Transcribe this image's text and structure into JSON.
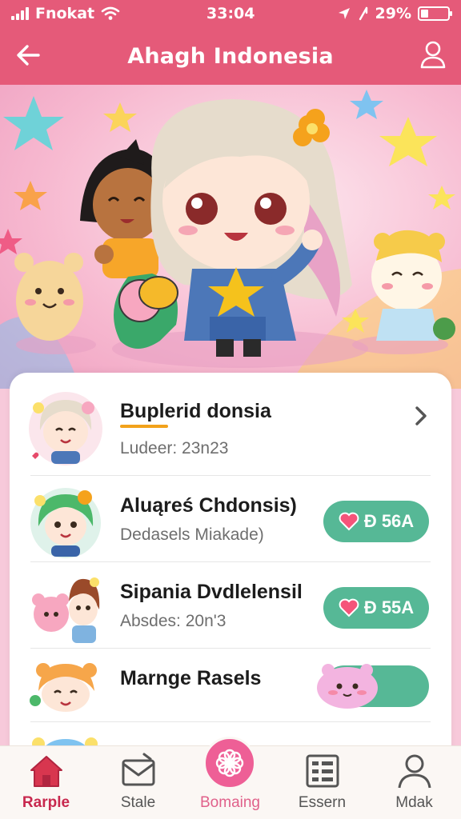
{
  "status_bar": {
    "carrier": "Fnokat",
    "time": "33:04",
    "battery": "29%",
    "battery_level": 0.29
  },
  "header": {
    "title": "Ahagh Indonesia"
  },
  "list": [
    {
      "title": "Buplerid donsia",
      "subtitle": "Ludeer: 23n23",
      "action": "chevron"
    },
    {
      "title": "Aluąreś Chdonsis)",
      "subtitle": "Dedasels Miakade)",
      "action": "pill",
      "pill_text": "Ð 56A"
    },
    {
      "title": "Sipania Dvdlelensil",
      "subtitle": "Absdes: 20n'3",
      "action": "pill",
      "pill_text": "Ð 55A"
    },
    {
      "title": "Marnge Rasels",
      "subtitle": "",
      "action": "toggle"
    }
  ],
  "bottom_nav": [
    {
      "label": "Rarple",
      "icon": "home-icon",
      "active": true
    },
    {
      "label": "Stale",
      "icon": "mail-icon",
      "active": false
    },
    {
      "label": "Bomaing",
      "icon": "flower-icon",
      "active": false
    },
    {
      "label": "Essern",
      "icon": "list-icon",
      "active": false
    },
    {
      "label": "Mdak",
      "icon": "user-icon",
      "active": false
    }
  ],
  "colors": {
    "brand": "#e55a79",
    "pill": "#56b896",
    "active_nav": "#c8284e",
    "center_nav": "#ee5f96"
  }
}
